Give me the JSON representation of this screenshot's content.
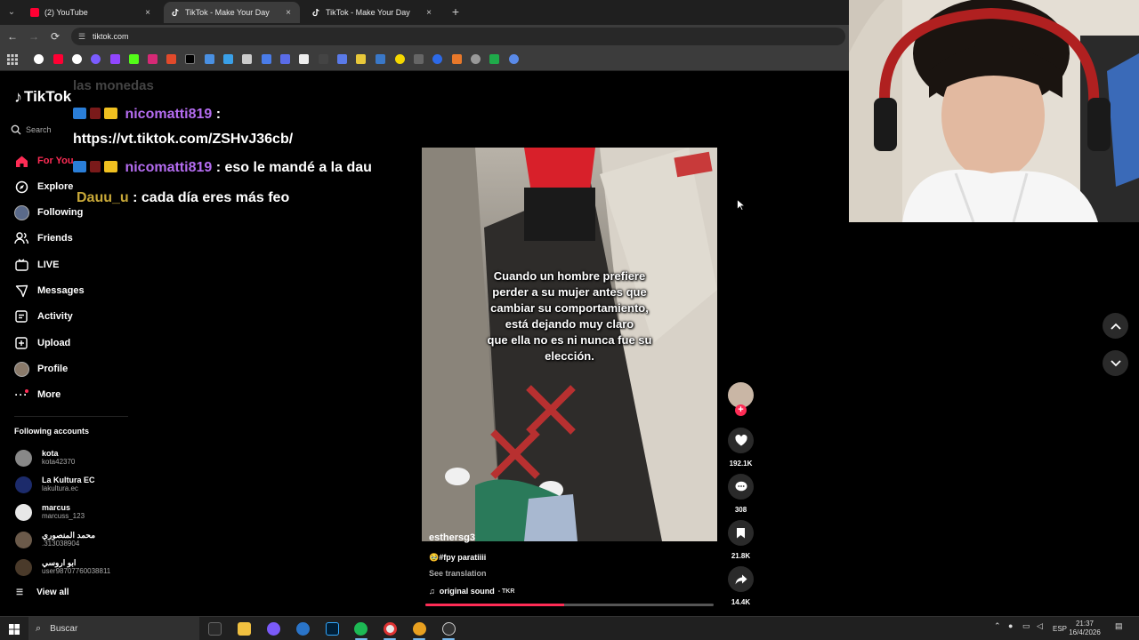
{
  "browser": {
    "tabs": [
      {
        "label": "(2) YouTube",
        "active": false,
        "favicon_color": "#ff0033"
      },
      {
        "label": "TikTok - Make Your Day",
        "active": true,
        "favicon_color": "#ffffff"
      },
      {
        "label": "TikTok - Make Your Day",
        "active": false,
        "favicon_color": "#ffffff"
      }
    ],
    "close_glyph": "×",
    "new_tab_glyph": "+",
    "address": "tiktok.com",
    "bookmark_icons": [
      "google-icon",
      "youtube-icon",
      "chrome-icon",
      "generic-icon",
      "twitch-icon",
      "kick-icon",
      "instagram-icon",
      "generic-icon",
      "x-icon",
      "translate-icon",
      "generic-icon",
      "stack-icon",
      "docs-icon",
      "notion-icon",
      "generic-icon",
      "generic-icon",
      "generic-icon",
      "generic-icon",
      "generic-icon",
      "generic-icon",
      "generic-icon",
      "generic-icon",
      "generic-icon",
      "sheets-icon",
      "generic-icon"
    ]
  },
  "tiktok": {
    "logo_text": "TikTok",
    "search_placeholder": "Search",
    "nav": [
      {
        "label": "For You",
        "icon": "home-icon",
        "active": true
      },
      {
        "label": "Explore",
        "icon": "compass-icon",
        "active": false
      },
      {
        "label": "Following",
        "icon": "following-avatar-icon",
        "active": false
      },
      {
        "label": "Friends",
        "icon": "friends-icon",
        "active": false
      },
      {
        "label": "LIVE",
        "icon": "live-icon",
        "active": false
      },
      {
        "label": "Messages",
        "icon": "messages-icon",
        "active": false
      },
      {
        "label": "Activity",
        "icon": "activity-icon",
        "active": false
      },
      {
        "label": "Upload",
        "icon": "upload-icon",
        "active": false
      },
      {
        "label": "Profile",
        "icon": "profile-icon",
        "active": false
      },
      {
        "label": "More",
        "icon": "more-icon",
        "active": false
      }
    ],
    "following_heading": "Following accounts",
    "accounts": [
      {
        "name": "kota",
        "handle": "kota42370",
        "color": "#888888"
      },
      {
        "name": "La Kultura EC",
        "handle": "lakultura.ec",
        "color": "#1c2b6b"
      },
      {
        "name": "marcus",
        "handle": "marcuss_123",
        "color": "#e8e8e8"
      },
      {
        "name": "محمد المنصوري",
        "handle": ".313038904",
        "color": "#6b5a4a"
      },
      {
        "name": "ابو اروسي",
        "handle": "user98707760038811",
        "color": "#4a3a2a"
      }
    ],
    "view_all": "View all"
  },
  "chat": {
    "faded_text": "las monedas",
    "messages": [
      {
        "user": "nicomatti819",
        "sep": " :",
        "text": ""
      },
      {
        "user": "",
        "sep": "",
        "text": "https://vt.tiktok.com/ZSHvJ36cb/"
      },
      {
        "user": "nicomatti819",
        "sep": " :",
        "text": " eso le mandé a la dau"
      },
      {
        "user": "Dauu_u",
        "sep": " :",
        "text": " cada día eres más feo"
      }
    ]
  },
  "video": {
    "caption_lines": [
      "Cuando un hombre prefiere",
      "perder a su mujer antes que",
      "cambiar su comportamiento,",
      "está dejando muy claro",
      "que ella no es ni nunca fue su",
      "elección."
    ],
    "author": "esthersg3",
    "description": "🥹#fpy paratiiii",
    "see_translation": "See translation",
    "sound": "original sound",
    "sound_sub": "- TKR",
    "progress": 0.48
  },
  "actions": {
    "likes": "192.1K",
    "comments": "308",
    "saves": "21.8K",
    "shares": "14.4K",
    "follow_glyph": "+"
  },
  "taskbar": {
    "search_placeholder": "Buscar",
    "apps": [
      "epic-games-icon",
      "file-explorer-icon",
      "discord-icon",
      "steam-icon",
      "photoshop-icon",
      "spotify-icon",
      "chrome-icon",
      "app-icon",
      "obs-icon"
    ],
    "language": "ESP",
    "time": "21:37",
    "date": "16/4/2026"
  },
  "colors": {
    "accent": "#fe2c55",
    "chat_user": "#b46cf0",
    "chat_user_alt": "#c8a838"
  }
}
